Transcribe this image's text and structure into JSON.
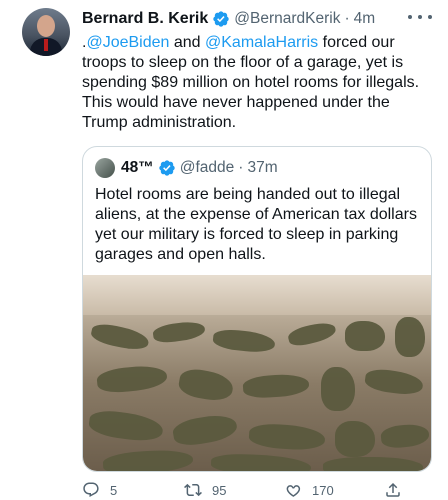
{
  "author": {
    "name": "Bernard B. Kerik",
    "handle": "@BernardKerik",
    "separator": "·",
    "time": "4m"
  },
  "tweet": {
    "prefix": ".",
    "mention1": "@JoeBiden",
    "and": " and ",
    "mention2": "@KamalaHarris",
    "body": " forced our troops to sleep on the floor of a garage, yet is spending $89 million on hotel rooms for illegals. This would have never happened under the Trump administration."
  },
  "quote": {
    "name": "48™",
    "handle": "@fadde",
    "separator": "·",
    "time": "37m",
    "text": "Hotel rooms are being handed out to illegal aliens, at the expense of American tax dollars yet our military is forced to sleep in parking garages and open halls."
  },
  "stats": {
    "replies": "5",
    "retweets": "95",
    "likes": "170"
  },
  "colors": {
    "link": "#1d9bf0",
    "secondary": "#536471",
    "verified": "#1d9bf0"
  },
  "icons": [
    "verified-badge-icon",
    "more-icon",
    "reply-icon",
    "retweet-icon",
    "like-icon",
    "share-icon"
  ]
}
